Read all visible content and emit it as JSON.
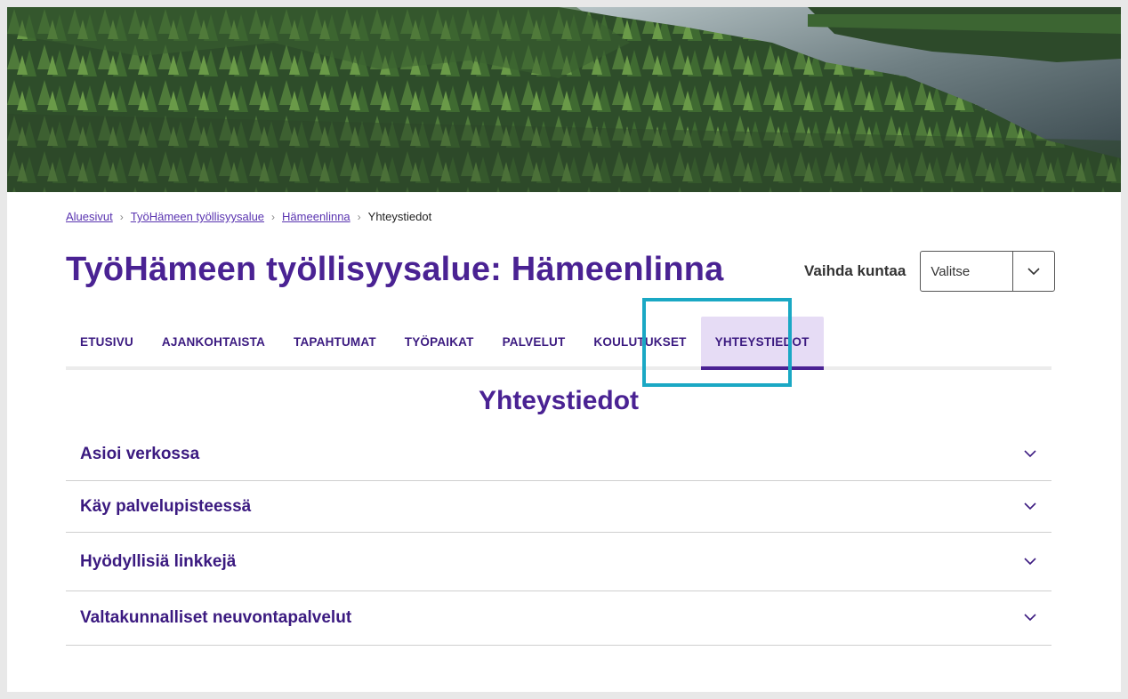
{
  "breadcrumb": {
    "items": [
      {
        "label": "Aluesivut",
        "link": true
      },
      {
        "label": "TyöHämeen työllisyysalue",
        "link": true
      },
      {
        "label": "Hämeenlinna",
        "link": true
      },
      {
        "label": "Yhteystiedot",
        "link": false
      }
    ]
  },
  "page": {
    "title": "TyöHämeen työllisyysalue: Hämeenlinna"
  },
  "municipality": {
    "label": "Vaihda kuntaa",
    "selected": "Valitse"
  },
  "tabs": [
    {
      "label": "ETUSIVU",
      "active": false
    },
    {
      "label": "AJANKOHTAISTA",
      "active": false
    },
    {
      "label": "TAPAHTUMAT",
      "active": false
    },
    {
      "label": "TYÖPAIKAT",
      "active": false
    },
    {
      "label": "PALVELUT",
      "active": false
    },
    {
      "label": "KOULUTUKSET",
      "active": false
    },
    {
      "label": "YHTEYSTIEDOT",
      "active": true
    }
  ],
  "section": {
    "title": "Yhteystiedot"
  },
  "accordion": [
    {
      "label": "Asioi verkossa"
    },
    {
      "label": "Käy palvelupisteessä"
    },
    {
      "label": "Hyödyllisiä linkkejä"
    },
    {
      "label": "Valtakunnalliset neuvontapalvelut"
    }
  ],
  "colors": {
    "brand_purple": "#4a2293",
    "active_tab_bg": "#e6dcf5",
    "highlight_box": "#1aa8c4"
  }
}
